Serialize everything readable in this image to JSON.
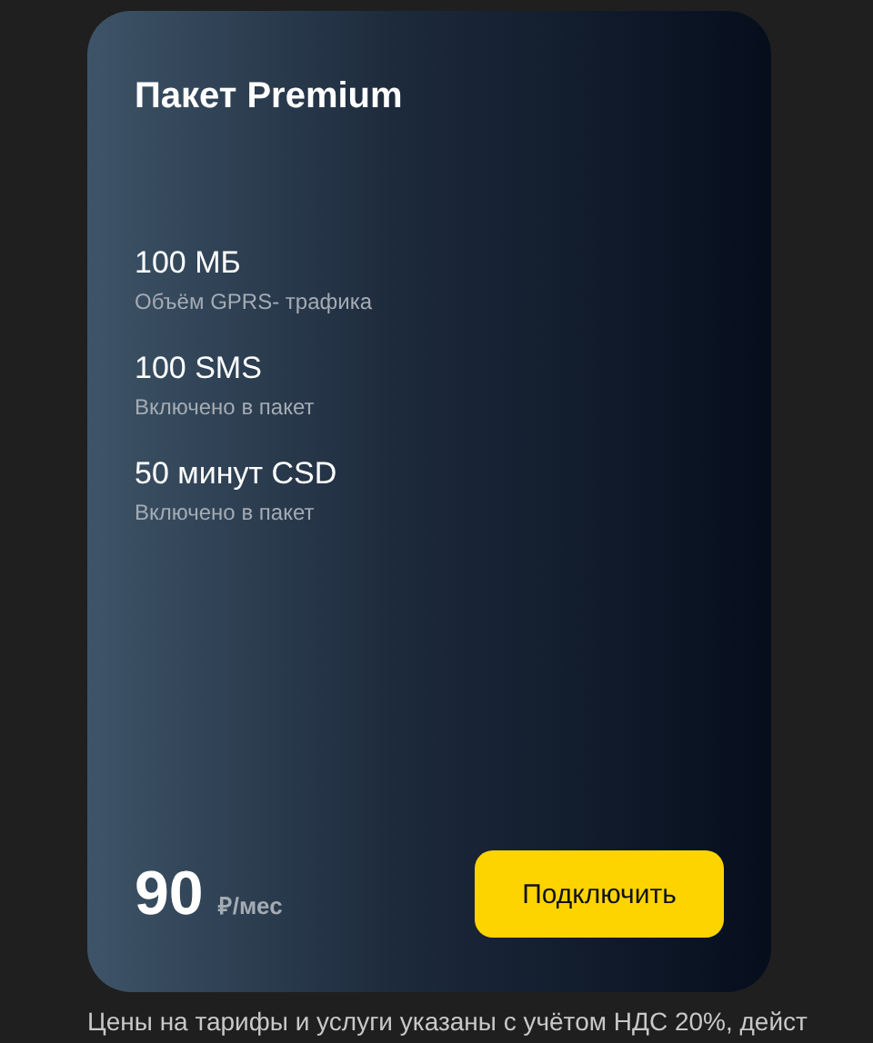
{
  "card": {
    "title": "Пакет Premium",
    "features": [
      {
        "value": "100 МБ",
        "caption": "Объём GPRS- трафика"
      },
      {
        "value": "100 SMS",
        "caption": "Включено в пакет"
      },
      {
        "value": "50 минут CSD",
        "caption": "Включено в пакет"
      }
    ],
    "price": "90",
    "price_unit": "₽/мес",
    "button": "Подключить"
  },
  "footnote": "Цены на тарифы и услуги указаны с учётом НДС 20%, дейст"
}
